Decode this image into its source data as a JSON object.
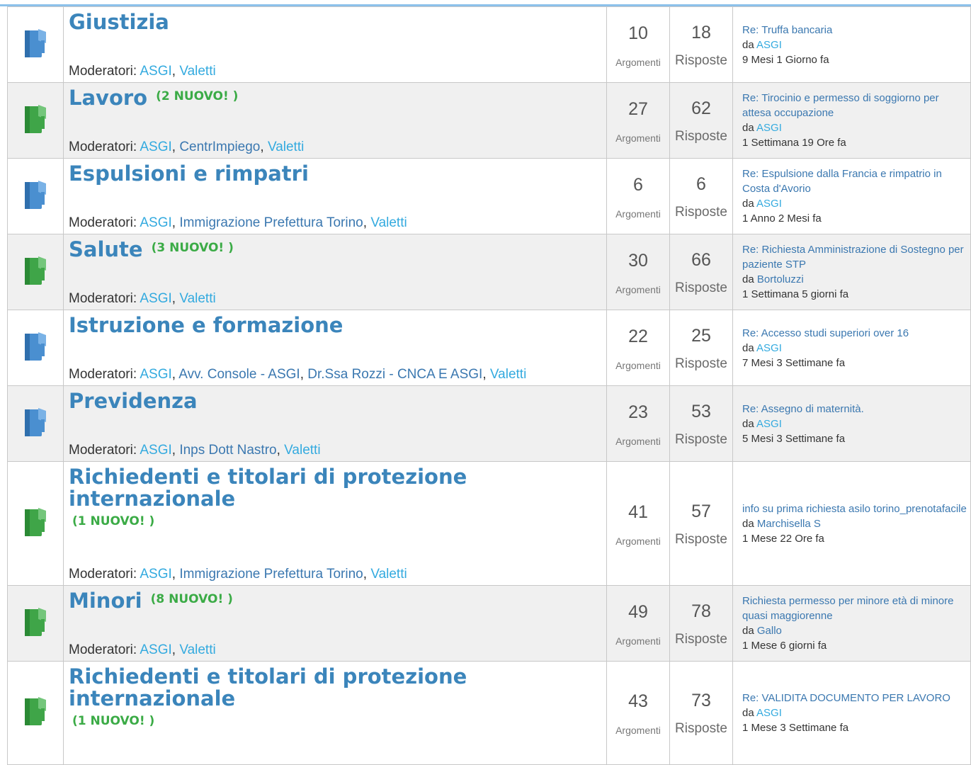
{
  "labels": {
    "moderators": "Moderatori:",
    "topics": "Argomenti",
    "replies": "Risposte",
    "by": "da"
  },
  "colors": {
    "title": "#3b85bb",
    "new_badge": "#3bab46",
    "folder_read": "#4a8fd0",
    "folder_unread": "#3fa548"
  },
  "categories": [
    {
      "title": "Giustizia",
      "new": "",
      "icon": "folder-read-icon",
      "moderators": [
        "ASGI",
        "Valetti"
      ],
      "topics": "10",
      "replies": "18",
      "last_topic": "Re: Truffa bancaria",
      "last_by": "ASGI",
      "last_ago": "9 Mesi 1 Giorno fa"
    },
    {
      "title": "Lavoro",
      "new": "(2 NUOVO! )",
      "icon": "folder-unread-icon",
      "moderators": [
        "ASGI",
        "CentrImpiego",
        "Valetti"
      ],
      "topics": "27",
      "replies": "62",
      "last_topic": "Re: Tirocinio e permesso di soggiorno per attesa occupazione",
      "last_by": "ASGI",
      "last_ago": "1 Settimana 19 Ore fa"
    },
    {
      "title": "Espulsioni e rimpatri",
      "new": "",
      "icon": "folder-read-icon",
      "moderators": [
        "ASGI",
        "Immigrazione Prefettura Torino",
        "Valetti"
      ],
      "topics": "6",
      "replies": "6",
      "last_topic": "Re: Espulsione dalla Francia e rimpatrio in Costa d'Avorio",
      "last_by": "ASGI",
      "last_ago": "1 Anno 2 Mesi fa"
    },
    {
      "title": "Salute",
      "new": "(3 NUOVO! )",
      "icon": "folder-unread-icon",
      "moderators": [
        "ASGI",
        "Valetti"
      ],
      "topics": "30",
      "replies": "66",
      "last_topic": "Re: Richiesta Amministrazione di Sostegno per paziente STP",
      "last_by": "Bortoluzzi",
      "last_ago": "1 Settimana 5 giorni fa"
    },
    {
      "title": "Istruzione e formazione",
      "new": "",
      "icon": "folder-read-icon",
      "moderators": [
        "ASGI",
        "Avv. Console - ASGI",
        "Dr.Ssa Rozzi - CNCA E ASGI",
        "Valetti"
      ],
      "topics": "22",
      "replies": "25",
      "last_topic": "Re: Accesso studi superiori over 16",
      "last_by": "ASGI",
      "last_ago": "7 Mesi 3 Settimane fa"
    },
    {
      "title": "Previdenza",
      "new": "",
      "icon": "folder-read-icon",
      "moderators": [
        "ASGI",
        "Inps Dott Nastro",
        "Valetti"
      ],
      "topics": "23",
      "replies": "53",
      "last_topic": "Re: Assegno di maternità.",
      "last_by": "ASGI",
      "last_ago": "5 Mesi 3 Settimane fa"
    },
    {
      "title": "Richiedenti e titolari di protezione internazionale",
      "new": "(1 NUOVO! )",
      "icon": "folder-unread-icon",
      "moderators": [
        "ASGI",
        "Immigrazione Prefettura Torino",
        "Valetti"
      ],
      "topics": "41",
      "replies": "57",
      "last_topic": "info su prima richiesta asilo torino_prenotafacile",
      "last_by": "Marchisella S",
      "last_ago": "1 Mese 22 Ore fa"
    },
    {
      "title": "Minori",
      "new": "(8 NUOVO! )",
      "icon": "folder-unread-icon",
      "moderators": [
        "ASGI",
        "Valetti"
      ],
      "topics": "49",
      "replies": "78",
      "last_topic": "Richiesta permesso per minore età di minore quasi maggiorenne",
      "last_by": "Gallo",
      "last_ago": "1 Mese 6 giorni fa"
    },
    {
      "title": "Richiedenti e titolari di protezione internazionale",
      "new": "(1 NUOVO! )",
      "icon": "folder-unread-icon",
      "moderators": [],
      "topics": "43",
      "replies": "73",
      "last_topic": "Re: VALIDITA DOCUMENTO PER LAVORO",
      "last_by": "ASGI",
      "last_ago": "1 Mese 3 Settimane fa"
    }
  ]
}
